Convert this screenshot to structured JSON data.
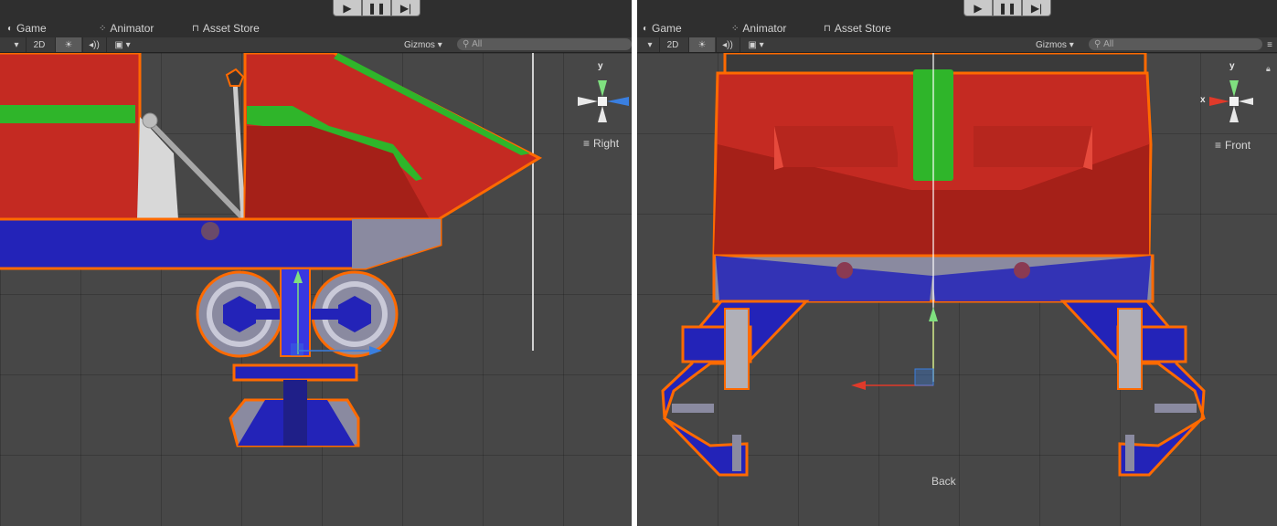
{
  "left_view": {
    "tabs": {
      "game": "Game",
      "animator": "Animator",
      "asset_store": "Asset Store"
    },
    "toolbar": {
      "mode_2d": "2D",
      "gizmos": "Gizmos",
      "search_placeholder": "All"
    },
    "orientation": {
      "view_name": "Right",
      "y_axis": "y"
    }
  },
  "right_view": {
    "tabs": {
      "game": "Game",
      "animator": "Animator",
      "asset_store": "Asset Store"
    },
    "toolbar": {
      "mode_2d": "2D",
      "gizmos": "Gizmos",
      "search_placeholder": "All"
    },
    "orientation": {
      "view_name": "Front",
      "y_axis": "y",
      "x_axis": "x"
    },
    "bottom_label": "Back"
  },
  "colors": {
    "selection_outline": "#ff6a00",
    "model_red": "#c42a22",
    "model_green": "#2fb52a",
    "model_blue": "#2323b8",
    "model_gray": "#8a8aa0",
    "background": "#474747"
  }
}
